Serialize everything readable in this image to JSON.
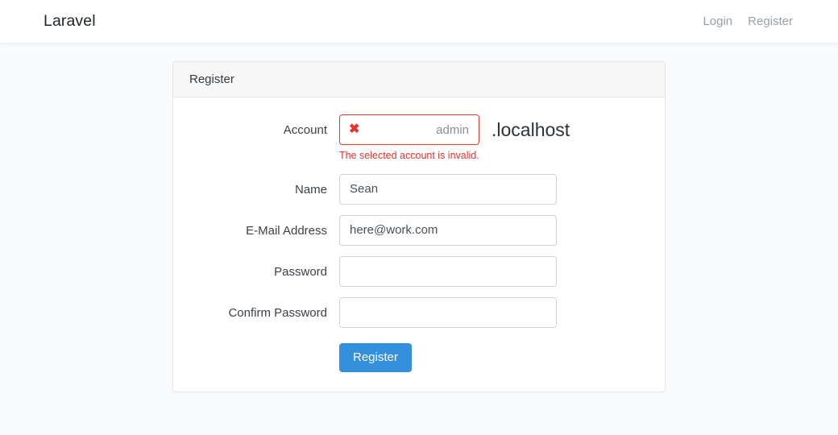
{
  "navbar": {
    "brand": "Laravel",
    "links": [
      {
        "label": "Login",
        "name": "nav-link-login"
      },
      {
        "label": "Register",
        "name": "nav-link-register"
      }
    ]
  },
  "card": {
    "header_title": "Register",
    "fields": [
      {
        "label": "Account",
        "value": "",
        "placeholder": "admin",
        "suffix": ".localhost",
        "error": "The selected account is invalid.",
        "invalid_icon": "times-icon",
        "invalid_icon_glyph": "✖"
      },
      {
        "label": "Name",
        "value": "Sean",
        "placeholder": ""
      },
      {
        "label": "E-Mail Address",
        "value": "here@work.com",
        "placeholder": ""
      },
      {
        "label": "Password",
        "value": "",
        "placeholder": ""
      },
      {
        "label": "Confirm Password",
        "value": "",
        "placeholder": ""
      }
    ],
    "submit_label": "Register"
  },
  "colors": {
    "page_background": "#f8fafc",
    "primary": "#3490dc",
    "danger": "#e3342f",
    "border": "#ced4da",
    "text": "#3d4146"
  }
}
